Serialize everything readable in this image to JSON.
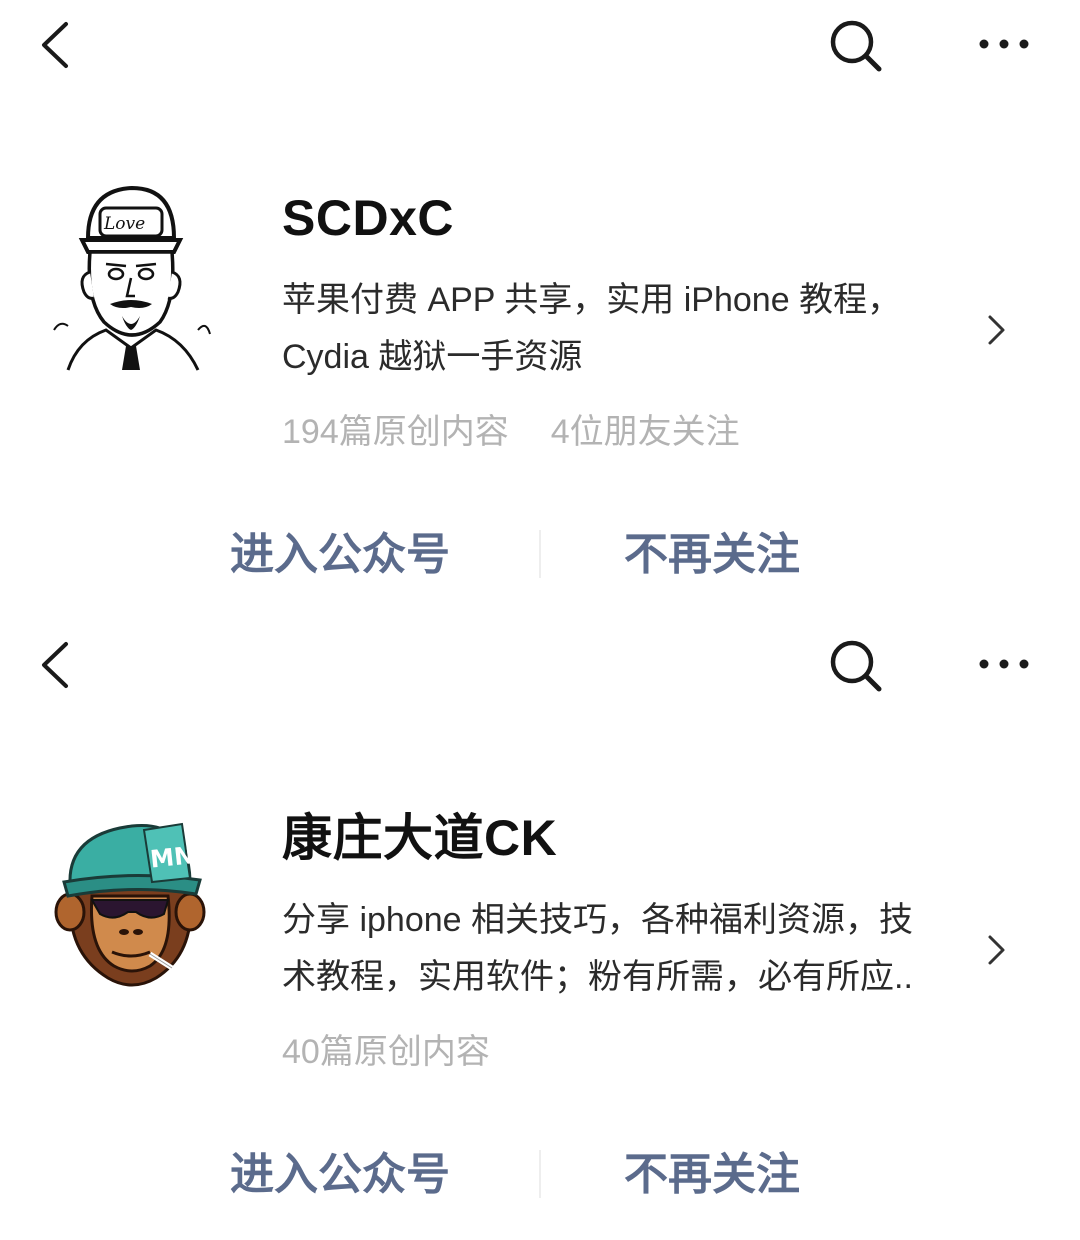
{
  "nav": {
    "back_icon": "chevron-left-icon",
    "search_icon": "search-icon",
    "more_icon": "more-horizontal-icon"
  },
  "accounts": [
    {
      "name": "SCDxC",
      "description_lines": [
        "苹果付费 APP 共享，实用 iPhone 教程，",
        "Cydia 越狱一手资源"
      ],
      "original_count": "194篇原创内容",
      "friends_following": "4位朋友关注",
      "enter_label": "进入公众号",
      "unfollow_label": "不再关注",
      "avatar_icon": "cartoon-man-cap-avatar"
    },
    {
      "name": "康庄大道CK",
      "description_lines": [
        "分享 iphone 相关技巧，各种福利资源，技",
        "术教程，实用软件；粉有所需，必有所应.."
      ],
      "original_count": "40篇原创内容",
      "enter_label": "进入公众号",
      "unfollow_label": "不再关注",
      "avatar_icon": "monkey-cap-avatar",
      "avatar_cap_text": "MNK",
      "cap_color": "#3aaea3"
    }
  ],
  "colors": {
    "action_text": "#5b6b8c",
    "stats_text": "#b3b3b3",
    "name_text": "#111111"
  }
}
